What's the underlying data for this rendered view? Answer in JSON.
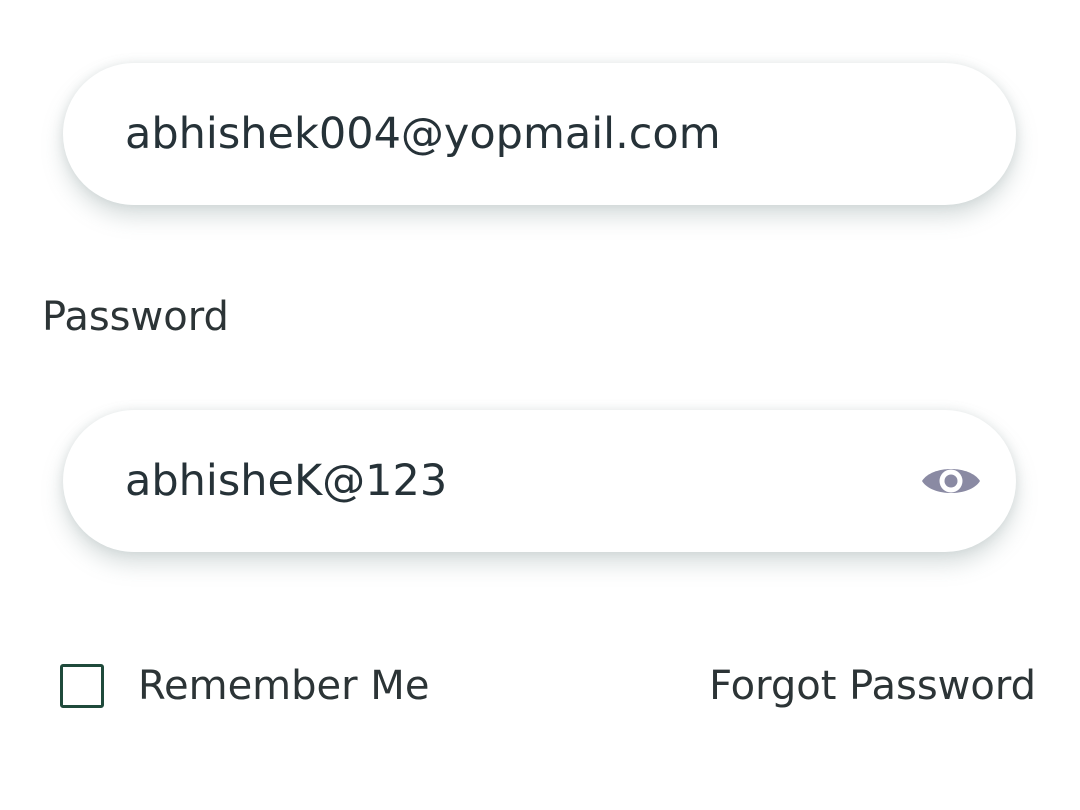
{
  "email_field": {
    "value": "abhishek004@yopmail.com"
  },
  "password": {
    "label": "Password",
    "value": "abhisheK@123",
    "visibility_icon": "eye-icon"
  },
  "remember_me": {
    "label": "Remember Me",
    "checked": false
  },
  "forgot_password": {
    "label": "Forgot Password"
  },
  "colors": {
    "text": "#263238",
    "icon": "#8a8aa3",
    "checkbox_border": "#1f4a3b",
    "background": "#ffffff"
  }
}
